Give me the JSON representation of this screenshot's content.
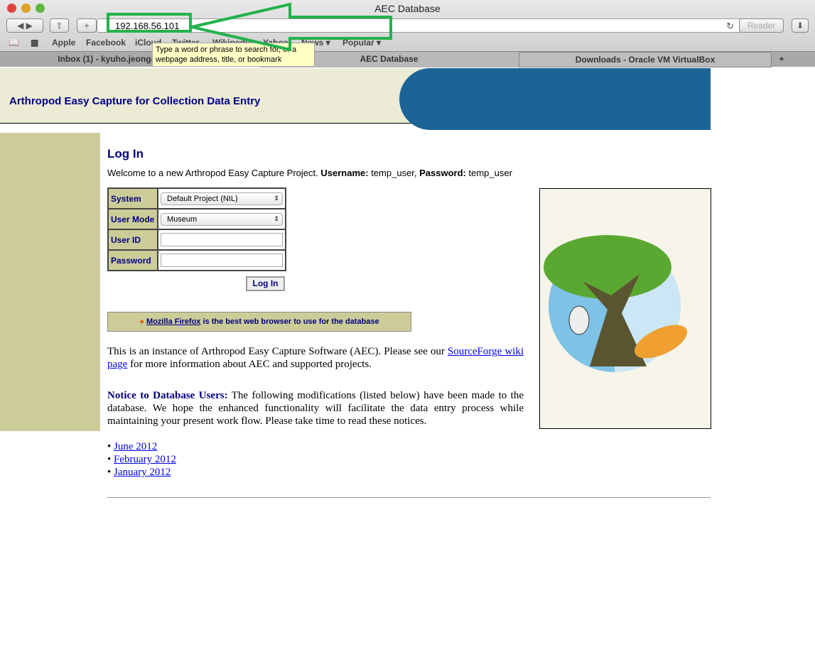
{
  "window": {
    "title": "AEC Database"
  },
  "toolbar": {
    "url": "192.168.56.101",
    "reader": "Reader"
  },
  "bookmarks": [
    "Apple",
    "Facebook",
    "iCloud",
    "Twitter",
    "Wikipedia",
    "Yahoo",
    "News ▾",
    "Popular ▾"
  ],
  "tooltip": "Type a word or phrase to search for, or a webpage address, title, or bookmark",
  "tabs": [
    "Inbox (1) - kyuho.jeong@gmail.com",
    "AEC Database",
    "Downloads - Oracle VM VirtualBox"
  ],
  "header": {
    "title": "Arthropod Easy Capture for Collection Data Entry"
  },
  "login": {
    "heading": "Log In",
    "welcome": "Welcome to a new Arthropod Easy Capture Project.",
    "username_label": "Username:",
    "username": "temp_user",
    "password_label": "Password:",
    "password": "temp_user",
    "system_label": "System",
    "system_value": "Default Project (NIL)",
    "mode_label": "User Mode",
    "mode_value": "Museum",
    "userid_label": "User ID",
    "userid_value": "",
    "pw_label": "Password",
    "pw_value": "",
    "button": "Log In"
  },
  "firefox": {
    "link": "Mozilla Firefox",
    "text": " is the best web browser to use for the database"
  },
  "intro": {
    "text1": "This is an instance of Arthropod Easy Capture Software (AEC). Please see our ",
    "link": "SourceForge wiki page",
    "text2": " for more information about AEC and supported projects."
  },
  "notice": {
    "title": "Notice to Database Users:",
    "text": " The following modifications (listed below) have been made to the database. We hope the enhanced functionality will facilitate the data entry process while maintaining your present work flow. Please take time to read these notices."
  },
  "notices": [
    "June 2012",
    "February 2012",
    "January 2012"
  ],
  "colors": {
    "header_blue": "#1c6396",
    "sidebar": "#cccc99",
    "annotation": "#22b24c"
  }
}
